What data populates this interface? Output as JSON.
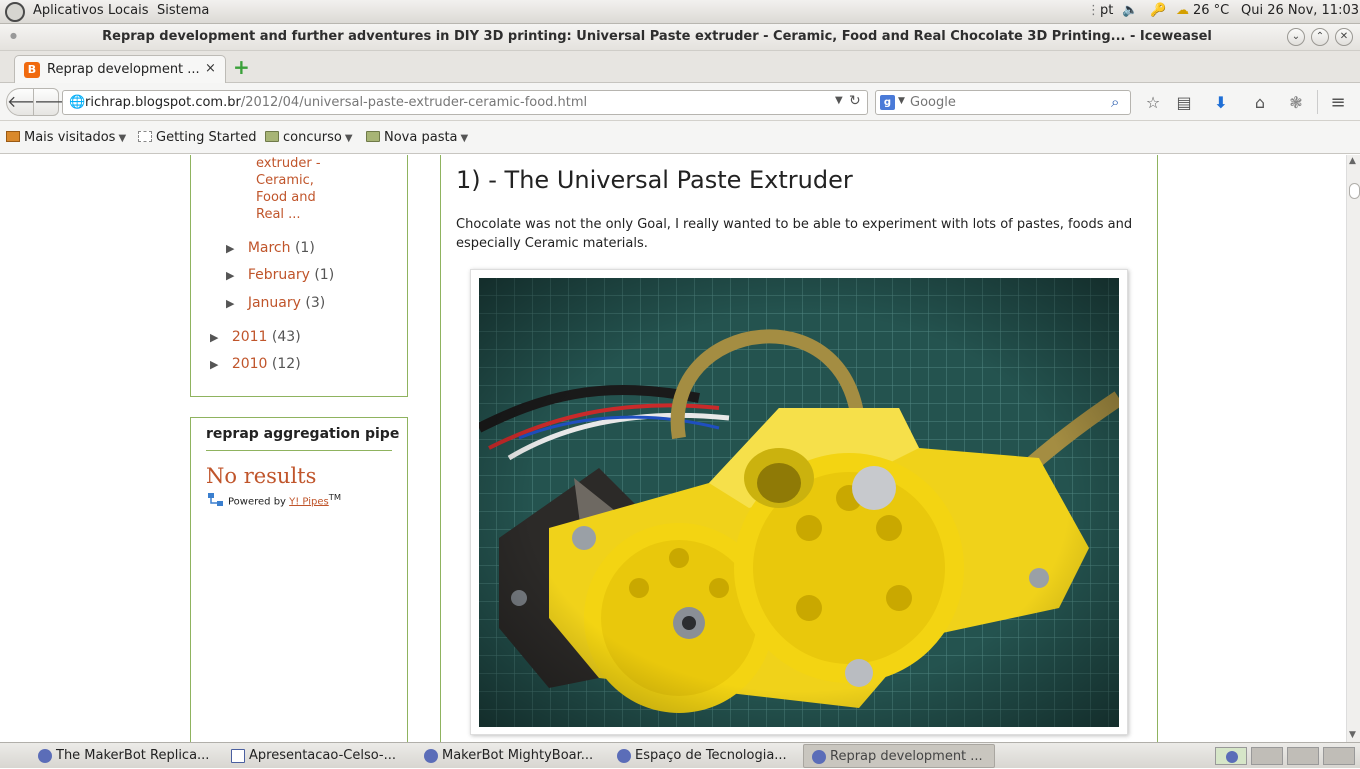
{
  "panel": {
    "menus": [
      "Aplicativos",
      "Locais",
      "Sistema"
    ],
    "keyboard": "pt",
    "weather": "26 °C",
    "clock": "Qui 26 Nov, 11:03"
  },
  "window": {
    "title": "Reprap development and further adventures in DIY 3D printing: Universal Paste extruder - Ceramic, Food and Real Chocolate 3D Printing... - Iceweasel"
  },
  "tab": {
    "label": "Reprap development ...",
    "close": "×",
    "new_tab": "+"
  },
  "nav": {
    "url_domain": "richrap.blogspot.com.br",
    "url_path": "/2012/04/universal-paste-extruder-ceramic-food.html",
    "search_placeholder": "Google"
  },
  "bookmarks": [
    {
      "label": "Mais visitados",
      "icon": "bookmark-folder-icon"
    },
    {
      "label": "Getting Started",
      "icon": "page-icon"
    },
    {
      "label": "concurso",
      "icon": "folder-icon"
    },
    {
      "label": "Nova pasta",
      "icon": "folder-icon"
    }
  ],
  "sidebar": {
    "current_post_lines": [
      "extruder -",
      "Ceramic,",
      "Food and",
      "Real ..."
    ],
    "months": [
      {
        "name": "March",
        "count": "(1)"
      },
      {
        "name": "February",
        "count": "(1)"
      },
      {
        "name": "January",
        "count": "(3)"
      }
    ],
    "years": [
      {
        "name": "2011",
        "count": "(43)"
      },
      {
        "name": "2010",
        "count": "(12)"
      }
    ],
    "pipe_title": "reprap aggregation pipe",
    "no_results": "No results",
    "powered_by": "Powered by ",
    "pipes_link": "Y! Pipes",
    "tm": "TM"
  },
  "post": {
    "heading": "1) - The Universal Paste Extruder",
    "paragraph": "Chocolate was not the only Goal, I really wanted to be able to experiment with lots of pastes, foods and especially Ceramic materials."
  },
  "taskbar": [
    {
      "label": "The MakerBot Replica...",
      "type": "browser"
    },
    {
      "label": "Apresentacao-Celso-...",
      "type": "doc"
    },
    {
      "label": "MakerBot MightyBoar...",
      "type": "browser"
    },
    {
      "label": "Espaço de Tecnologia...",
      "type": "browser"
    },
    {
      "label": "Reprap development ...",
      "type": "browser",
      "active": true
    }
  ]
}
